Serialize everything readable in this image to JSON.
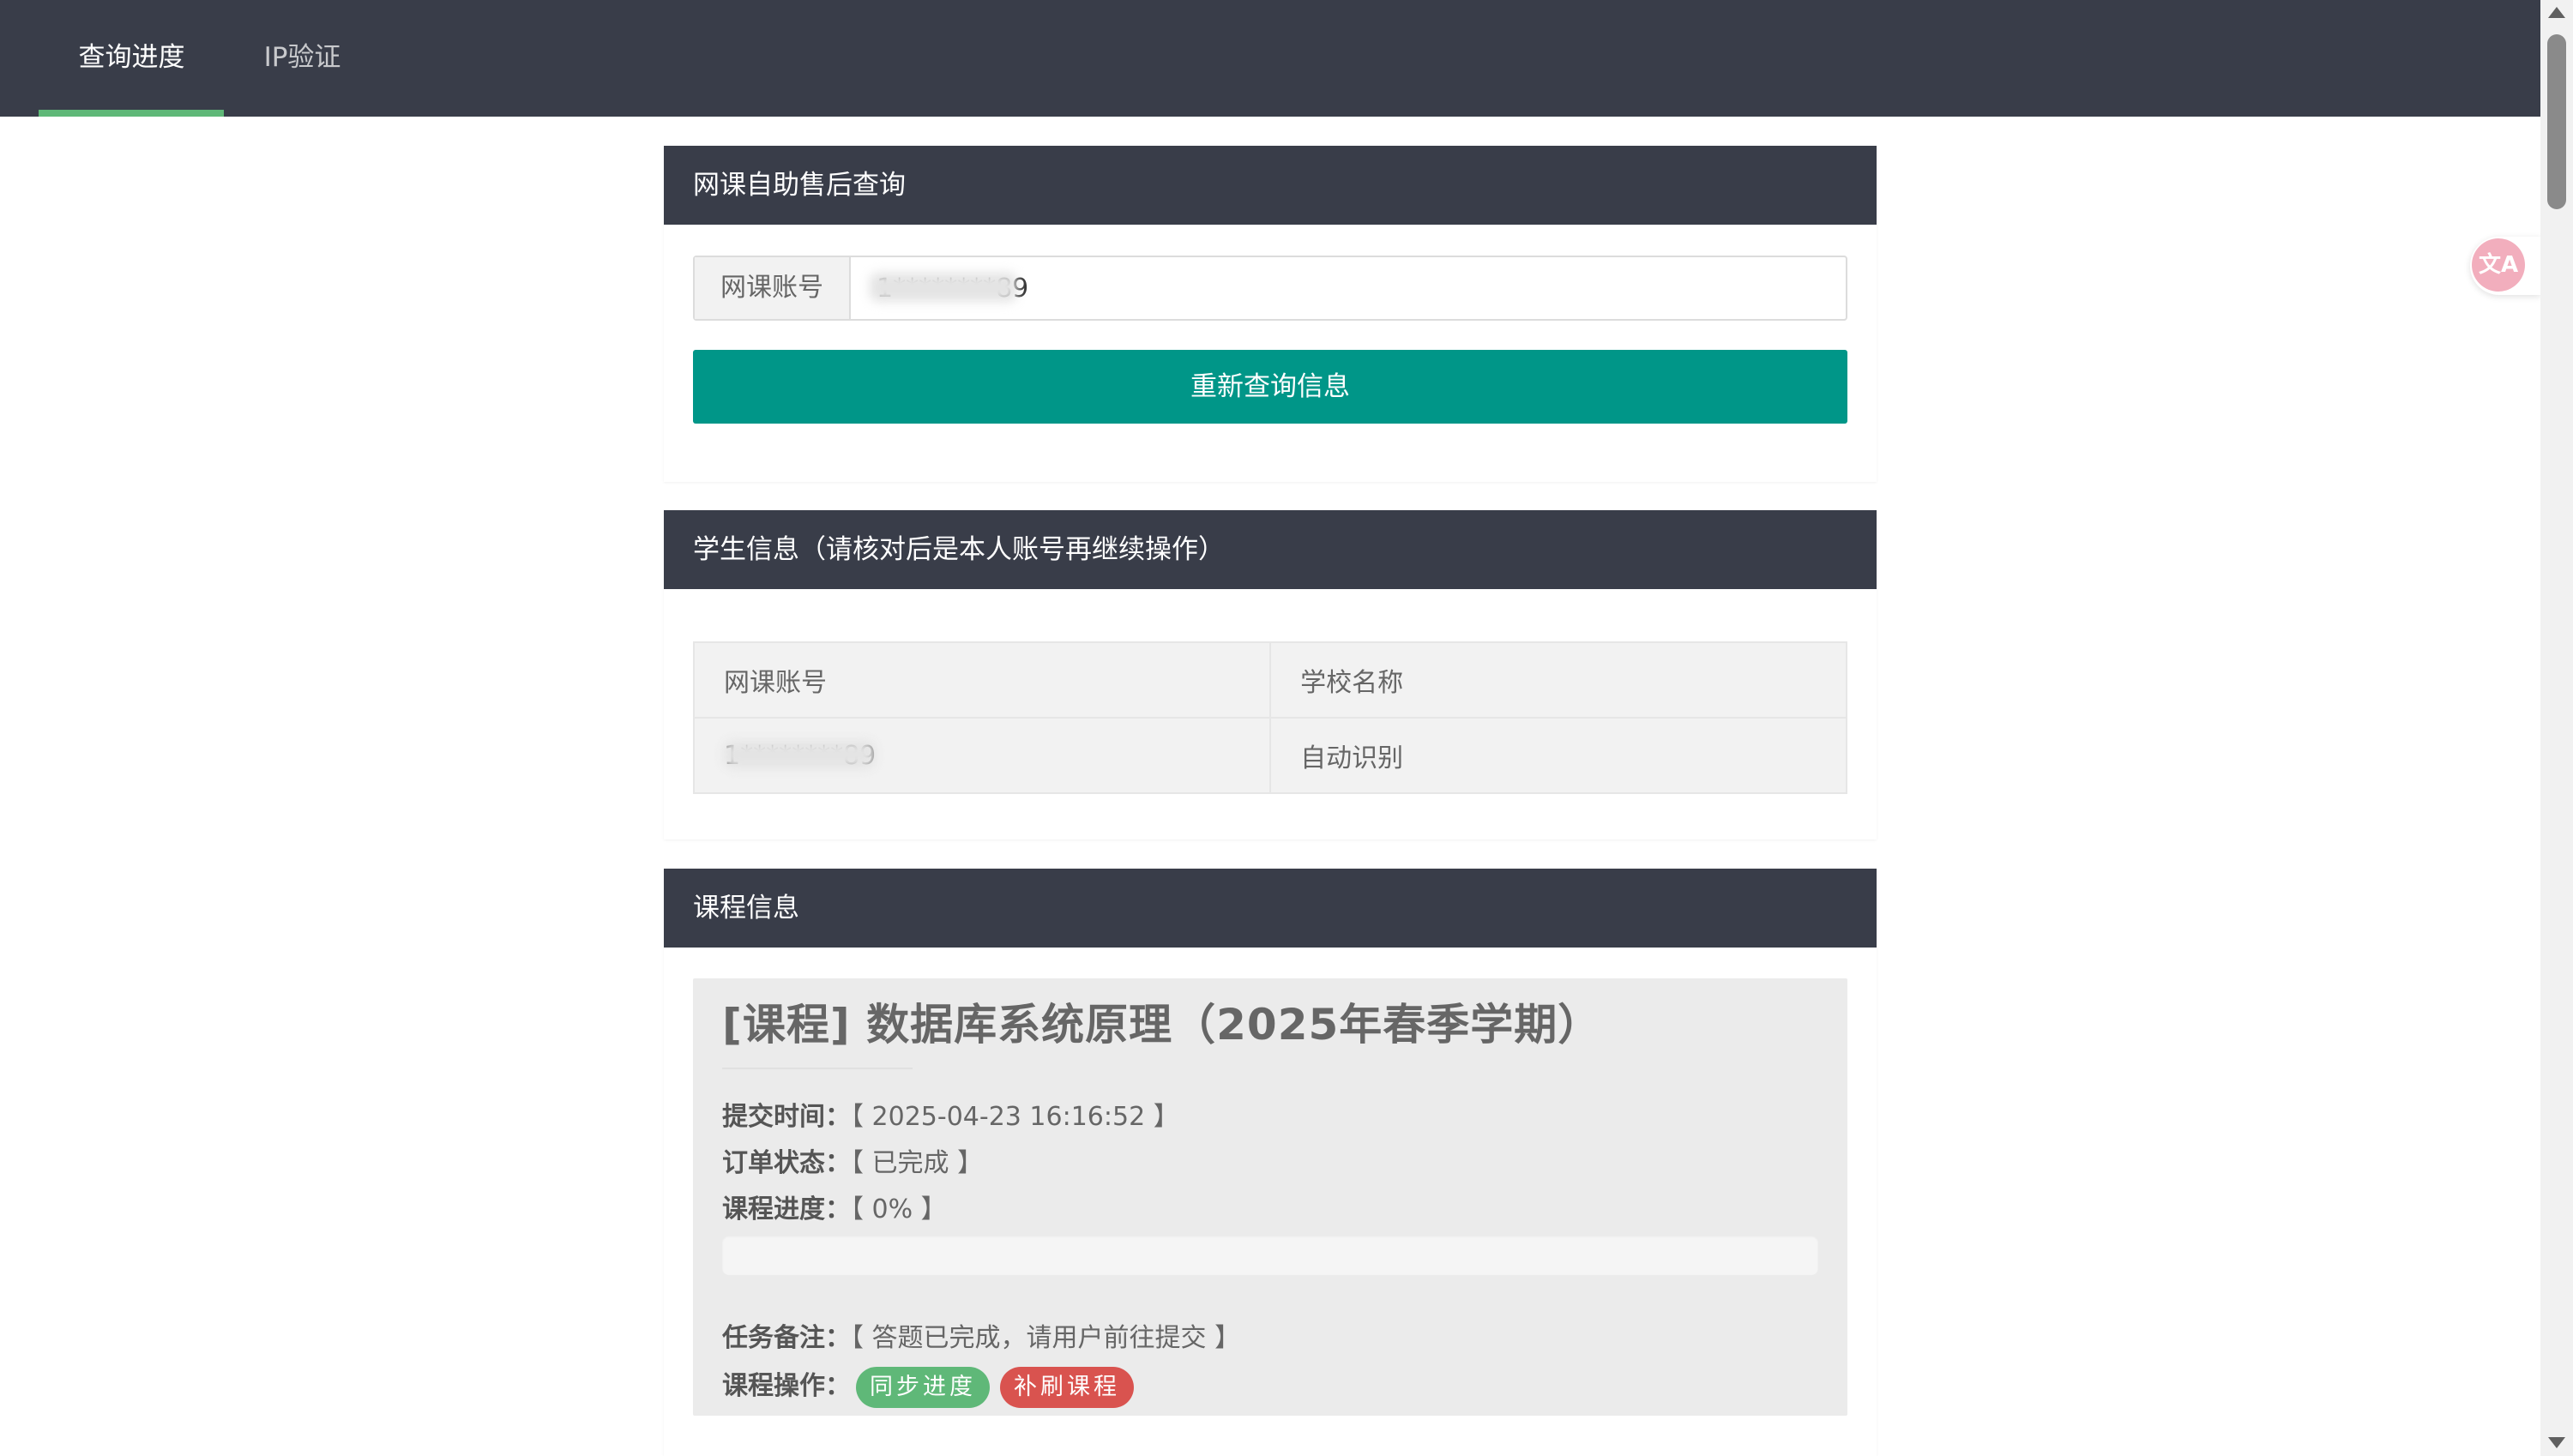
{
  "nav": {
    "tabs": [
      {
        "label": "查询进度",
        "active": true
      },
      {
        "label": "IP验证",
        "active": false
      }
    ],
    "accent_color": "#5fb878"
  },
  "query_card": {
    "title": "网课自助售后查询",
    "account_prefix": "网课账号",
    "account_value": "1********89",
    "button_label": "重新查询信息",
    "button_color": "#009688"
  },
  "student_card": {
    "title": "学生信息（请核对后是本人账号再继续操作）",
    "table": {
      "headers": [
        "网课账号",
        "学校名称"
      ],
      "rows": [
        [
          "1********89",
          "自动识别"
        ]
      ]
    }
  },
  "course_card": {
    "title": "课程信息",
    "course_title": "[课程] 数据库系统原理（2025年春季学期）",
    "submit_time_label": "提交时间：",
    "submit_time_value": "【 2025-04-23 16:16:52 】",
    "order_status_label": "订单状态：",
    "order_status_value": "【 已完成 】",
    "progress_label": "课程进度：",
    "progress_value": "【 0% 】",
    "progress_fraction": 0,
    "remark_label": "任务备注：",
    "remark_value": "【 答题已完成，请用户前往提交 】",
    "actions_label": "课程操作：",
    "actions": [
      {
        "label": "同步进度",
        "color": "#5fb878"
      },
      {
        "label": "补刷课程",
        "color": "#d9534f"
      }
    ]
  },
  "widgets": {
    "translate_icon": "translate-icon"
  }
}
